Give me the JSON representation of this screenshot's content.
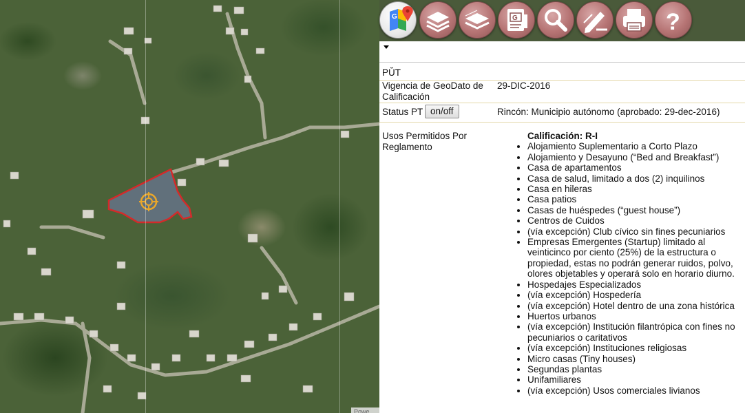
{
  "map": {
    "attribution": "Powe"
  },
  "toolbar": {
    "buttons": [
      {
        "name": "google-maps-button",
        "icon": "google-maps-icon"
      },
      {
        "name": "layers-button",
        "icon": "layers-icon"
      },
      {
        "name": "basemap-button",
        "icon": "stack-icon"
      },
      {
        "name": "document-button",
        "icon": "document-icon"
      },
      {
        "name": "search-button",
        "icon": "magnifier-icon"
      },
      {
        "name": "draw-button",
        "icon": "pencil-icon"
      },
      {
        "name": "print-button",
        "icon": "printer-icon"
      },
      {
        "name": "help-button",
        "icon": "question-icon"
      }
    ]
  },
  "panel": {
    "puт": "PŬT",
    "vigencia_label": "Vigencia de GeoDato de Calificación",
    "vigencia_value": "29-DIC-2016",
    "status_label": "Status PT",
    "status_button": "on/off",
    "status_value": "Rincón: Municipio autónomo (aprobado: 29-dec-2016)",
    "usos_label": "Usos Permitidos Por Reglamento",
    "usos_title": "Calificación: R-I",
    "usos_items": [
      "Alojamiento Suplementario a Corto Plazo",
      "Alojamiento y Desayuno (“Bed and Breakfast”)",
      "Casa de apartamentos",
      "Casa de salud, limitado a dos (2) inquilinos",
      "Casa en hileras",
      "Casa patios",
      "Casas de huéspedes (“guest house”)",
      "Centros de Cuidos",
      "(vía excepción) Club cívico sin fines pecuniarios",
      "Empresas Emergentes (Startup) limitado al veinticinco por ciento (25%) de la estructura o propiedad, estas no podrán generar ruidos, polvo, olores objetables y operará solo en horario diurno.",
      "Hospedajes Especializados",
      "(vía excepción) Hospedería",
      "(vía excepción) Hotel dentro de una zona histórica",
      "Huertos urbanos",
      "(vía excepción) Institución filantrópica con fines no pecuniarios o caritativos",
      "(vía excepción) Instituciones religiosas",
      "Micro casas (Tiny houses)",
      "Segundas plantas",
      "Unifamiliares",
      "(vía excepción) Usos comerciales livianos"
    ]
  },
  "colors": {
    "parcel_outline": "#d42a2a",
    "tool_button": "#b67474",
    "row_divider": "#e3d7a8"
  }
}
